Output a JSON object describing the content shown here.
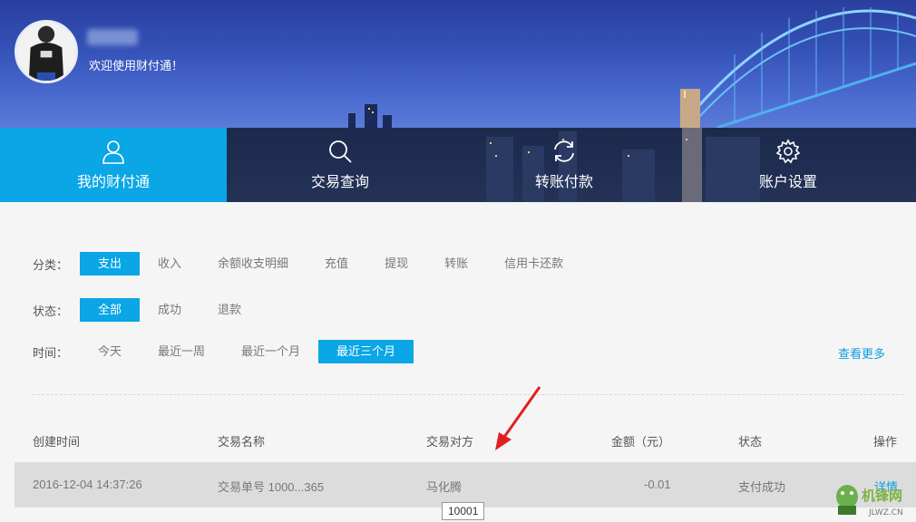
{
  "header": {
    "welcome": "欢迎使用财付通！"
  },
  "nav": {
    "items": [
      {
        "label": "我的财付通",
        "icon": "user-icon"
      },
      {
        "label": "交易查询",
        "icon": "search-icon"
      },
      {
        "label": "转账付款",
        "icon": "refresh-icon"
      },
      {
        "label": "账户设置",
        "icon": "gear-icon"
      }
    ],
    "active_index": 1
  },
  "filters": {
    "category": {
      "label": "分类：",
      "options": [
        "支出",
        "收入",
        "余额收支明细",
        "充值",
        "提现",
        "转账",
        "信用卡还款"
      ],
      "active": "支出"
    },
    "status": {
      "label": "状态：",
      "options": [
        "全部",
        "成功",
        "退款"
      ],
      "active": "全部"
    },
    "time": {
      "label": "时间：",
      "options": [
        "今天",
        "最近一周",
        "最近一个月",
        "最近三个月"
      ],
      "active": "最近三个月"
    },
    "more_label": "查看更多"
  },
  "table": {
    "headers": [
      "创建时间",
      "交易名称",
      "交易对方",
      "金额（元）",
      "状态",
      "操作"
    ],
    "rows": [
      {
        "time": "2016-12-04 14:37:26",
        "name": "交易单号  1000...365",
        "counterparty": "马化腾",
        "amount": "-0.01",
        "status": "支付成功",
        "action": "详情"
      }
    ]
  },
  "tooltip": "10001",
  "watermark": {
    "text": "机锋网",
    "url_text": "JLWZ.CN"
  },
  "colors": {
    "accent": "#0aa6e6",
    "nav_bg": "#1f2e52",
    "link": "#0a9fe0"
  }
}
